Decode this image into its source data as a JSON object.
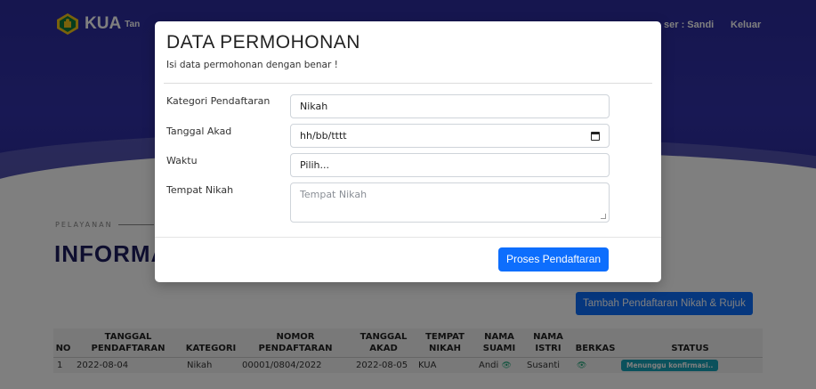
{
  "navbar": {
    "brand_name": "KUA",
    "brand_sub": "Tan",
    "user_label": "ser : Sandi",
    "logout_label": "Keluar"
  },
  "section": {
    "eyebrow": "PELAYANAN",
    "title": "INFORMA"
  },
  "add_button_label": "Tambah Pendaftaran Nikah & Rujuk",
  "table": {
    "headers": [
      {
        "line1": "",
        "line2": "NO"
      },
      {
        "line1": "TANGGAL",
        "line2": "PENDAFTARAN"
      },
      {
        "line1": "",
        "line2": "KATEGORI"
      },
      {
        "line1": "NOMOR",
        "line2": "PENDAFTARAN"
      },
      {
        "line1": "TANGGAL",
        "line2": "AKAD"
      },
      {
        "line1": "TEMPAT",
        "line2": "NIKAH"
      },
      {
        "line1": "NAMA",
        "line2": "SUAMI"
      },
      {
        "line1": "NAMA",
        "line2": "ISTRI"
      },
      {
        "line1": "",
        "line2": "BERKAS"
      },
      {
        "line1": "",
        "line2": "STATUS"
      }
    ],
    "rows": [
      {
        "no": "1",
        "tanggal_pendaftaran": "2022-08-04",
        "kategori": "Nikah",
        "nomor_pendaftaran": "00001/0804/2022",
        "tanggal_akad": "2022-08-05",
        "tempat_nikah": "KUA",
        "nama_suami": "Andi",
        "nama_istri": "Susanti",
        "status": "Menunggu konfirmasi.."
      }
    ]
  },
  "modal": {
    "title": "DATA PERMOHONAN",
    "subtitle": "Isi data permohonan dengan benar !",
    "fields": {
      "kategori": {
        "label": "Kategori Pendaftaran",
        "value": "Nikah"
      },
      "tanggal": {
        "label": "Tanggal Akad",
        "value": "hh/bb/tttt"
      },
      "waktu": {
        "label": "Waktu",
        "value": "Pilih..."
      },
      "tempat": {
        "label": "Tempat Nikah",
        "placeholder": "Tempat Nikah"
      }
    },
    "submit_label": "Proses Pendaftaran"
  },
  "colors": {
    "hero": "#2c2c9e",
    "primary": "#0d6efd",
    "badge": "#17a2b8",
    "eye_icon": "#1fa67a"
  },
  "icons": [
    "kemenag-logo-icon",
    "eye-icon",
    "calendar-icon"
  ]
}
